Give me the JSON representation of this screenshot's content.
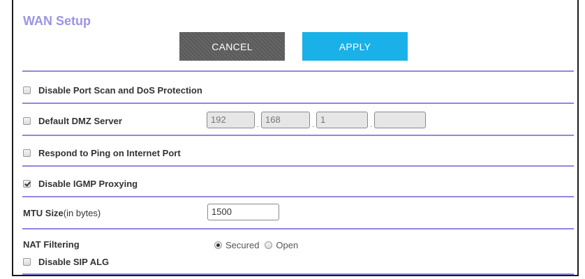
{
  "page": {
    "title": "WAN Setup"
  },
  "buttons": {
    "cancel": "CANCEL",
    "apply": "APPLY"
  },
  "options": {
    "port_scan": {
      "label": "Disable Port Scan and DoS Protection",
      "checked": false
    },
    "dmz": {
      "label": "Default DMZ Server",
      "checked": false,
      "ip": [
        "192",
        "168",
        "1",
        ""
      ]
    },
    "ping": {
      "label": "Respond to Ping on Internet Port",
      "checked": false
    },
    "igmp": {
      "label": "Disable IGMP Proxying",
      "checked": true
    },
    "mtu": {
      "label_bold": "MTU Size",
      "label_rest": "(in bytes)",
      "value": "1500"
    },
    "nat": {
      "label": "NAT Filtering",
      "selected": "Secured",
      "options": [
        "Secured",
        "Open"
      ]
    },
    "sip": {
      "label": "Disable SIP ALG",
      "checked": false
    }
  },
  "colors": {
    "accent": "#9b94e6",
    "divider": "#8e88e2",
    "apply": "#1ab0e8",
    "cancel": "#5f5f5f"
  }
}
